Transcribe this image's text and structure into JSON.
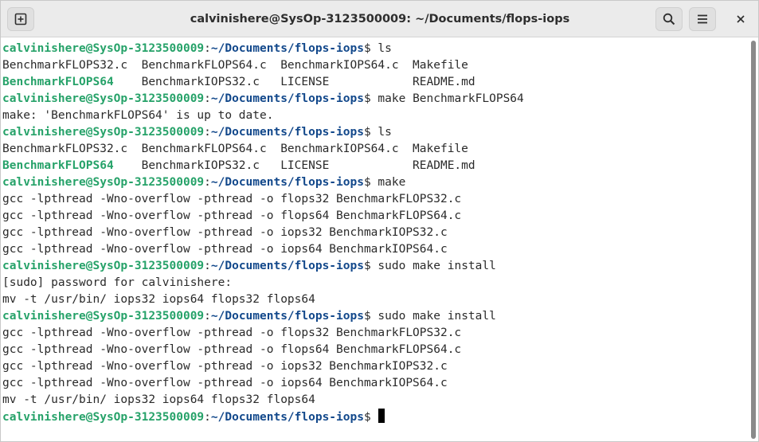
{
  "window": {
    "title": "calvinishere@SysOp-3123500009: ~/Documents/flops-iops"
  },
  "titlebar_icons": {
    "new_tab": "new-tab-icon",
    "search": "search-icon",
    "menu": "hamburger-menu-icon",
    "close": "close-icon"
  },
  "colors": {
    "prompt_user": "#26a269",
    "prompt_path": "#12488b",
    "executable": "#26a269",
    "text": "#2a2a2a"
  },
  "prompt": {
    "user_host": "calvinishere@SysOp-3123500009",
    "path": "~/Documents/flops-iops"
  },
  "terminal": {
    "lines": [
      {
        "kind": "prompt",
        "cmd": " ls"
      },
      {
        "kind": "ls",
        "cells": [
          "BenchmarkFLOPS32.c",
          "BenchmarkFLOPS64.c",
          "BenchmarkIOPS64.c",
          "Makefile"
        ],
        "exec": [
          false,
          false,
          false,
          false
        ]
      },
      {
        "kind": "ls",
        "cells": [
          "BenchmarkFLOPS64",
          "BenchmarkIOPS32.c",
          "LICENSE",
          "README.md"
        ],
        "exec": [
          true,
          false,
          false,
          false
        ]
      },
      {
        "kind": "prompt",
        "cmd": " make BenchmarkFLOPS64"
      },
      {
        "kind": "out",
        "text": "make: 'BenchmarkFLOPS64' is up to date."
      },
      {
        "kind": "prompt",
        "cmd": " ls"
      },
      {
        "kind": "ls",
        "cells": [
          "BenchmarkFLOPS32.c",
          "BenchmarkFLOPS64.c",
          "BenchmarkIOPS64.c",
          "Makefile"
        ],
        "exec": [
          false,
          false,
          false,
          false
        ]
      },
      {
        "kind": "ls",
        "cells": [
          "BenchmarkFLOPS64",
          "BenchmarkIOPS32.c",
          "LICENSE",
          "README.md"
        ],
        "exec": [
          true,
          false,
          false,
          false
        ]
      },
      {
        "kind": "prompt",
        "cmd": " make"
      },
      {
        "kind": "out",
        "text": "gcc -lpthread -Wno-overflow -pthread -o flops32 BenchmarkFLOPS32.c"
      },
      {
        "kind": "out",
        "text": "gcc -lpthread -Wno-overflow -pthread -o flops64 BenchmarkFLOPS64.c"
      },
      {
        "kind": "out",
        "text": "gcc -lpthread -Wno-overflow -pthread -o iops32 BenchmarkIOPS32.c"
      },
      {
        "kind": "out",
        "text": "gcc -lpthread -Wno-overflow -pthread -o iops64 BenchmarkIOPS64.c"
      },
      {
        "kind": "prompt",
        "cmd": " sudo make install"
      },
      {
        "kind": "out",
        "text": "[sudo] password for calvinishere:"
      },
      {
        "kind": "out",
        "text": "mv -t /usr/bin/ iops32 iops64 flops32 flops64"
      },
      {
        "kind": "prompt",
        "cmd": " sudo make install"
      },
      {
        "kind": "out",
        "text": "gcc -lpthread -Wno-overflow -pthread -o flops32 BenchmarkFLOPS32.c"
      },
      {
        "kind": "out",
        "text": "gcc -lpthread -Wno-overflow -pthread -o flops64 BenchmarkFLOPS64.c"
      },
      {
        "kind": "out",
        "text": "gcc -lpthread -Wno-overflow -pthread -o iops32 BenchmarkIOPS32.c"
      },
      {
        "kind": "out",
        "text": "gcc -lpthread -Wno-overflow -pthread -o iops64 BenchmarkIOPS64.c"
      },
      {
        "kind": "out",
        "text": "mv -t /usr/bin/ iops32 iops64 flops32 flops64"
      },
      {
        "kind": "prompt",
        "cmd": " ",
        "cursor": true
      }
    ]
  }
}
